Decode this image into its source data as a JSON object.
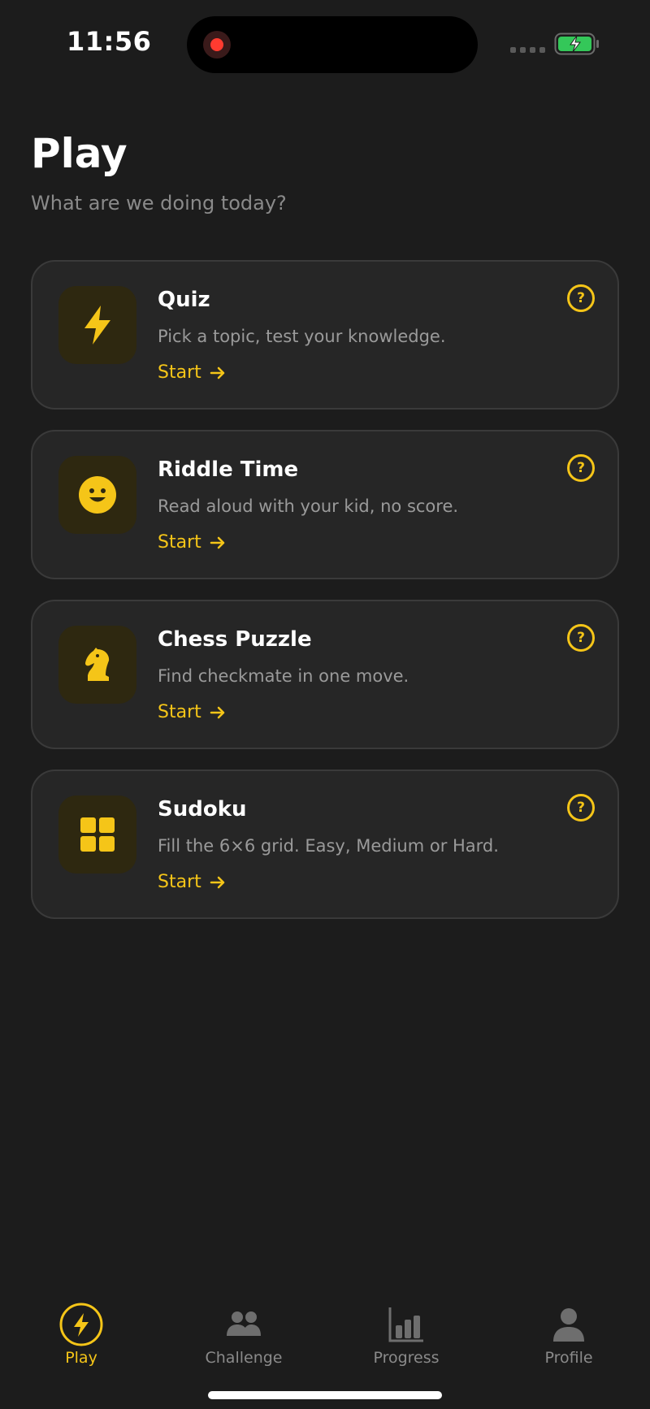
{
  "status_bar": {
    "time": "11:56"
  },
  "header": {
    "title": "Play",
    "subtitle": "What are we doing today?"
  },
  "cards": [
    {
      "title": "Quiz",
      "description": "Pick a topic, test your knowledge.",
      "start_label": "Start",
      "icon": "lightning-icon",
      "help_label": "?"
    },
    {
      "title": "Riddle Time",
      "description": "Read aloud with your kid, no score.",
      "start_label": "Start",
      "icon": "smiley-icon",
      "help_label": "?"
    },
    {
      "title": "Chess Puzzle",
      "description": "Find checkmate in one move.",
      "start_label": "Start",
      "icon": "chess-knight-icon",
      "help_label": "?"
    },
    {
      "title": "Sudoku",
      "description": "Fill the 6×6 grid. Easy, Medium or Hard.",
      "start_label": "Start",
      "icon": "grid-icon",
      "help_label": "?"
    }
  ],
  "tabbar": {
    "tabs": [
      {
        "label": "Play",
        "icon": "lightning-icon",
        "active": true
      },
      {
        "label": "Challenge",
        "icon": "people-icon",
        "active": false
      },
      {
        "label": "Progress",
        "icon": "bar-chart-icon",
        "active": false
      },
      {
        "label": "Profile",
        "icon": "person-icon",
        "active": false
      }
    ]
  },
  "colors": {
    "background": "#1c1c1c",
    "card": "#262626",
    "accent": "#f5c518",
    "muted_text": "#8a8a8a",
    "record": "#ff3b30",
    "battery": "#34c759"
  }
}
